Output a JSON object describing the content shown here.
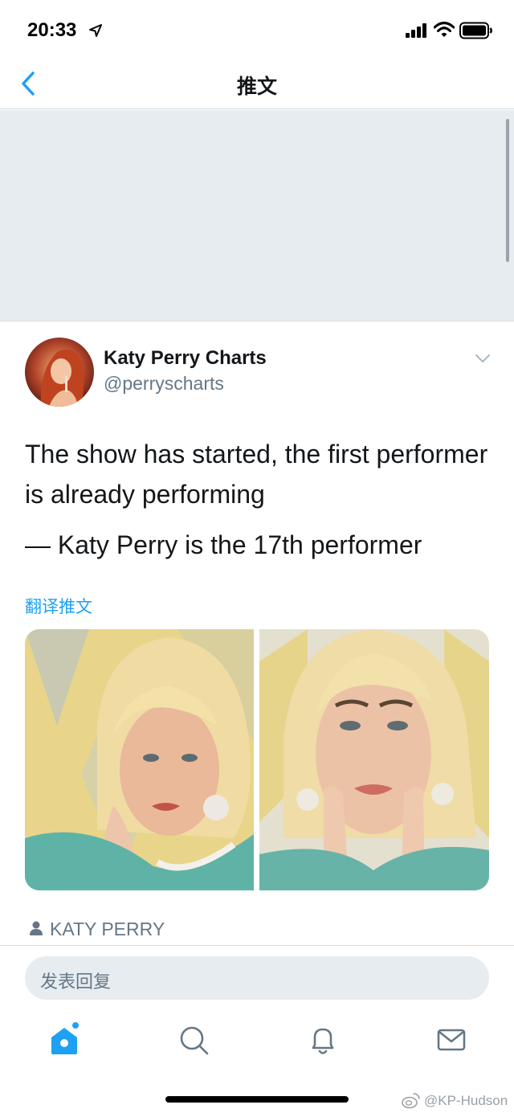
{
  "status_bar": {
    "time": "20:33"
  },
  "nav": {
    "title": "推文"
  },
  "tweet": {
    "display_name": "Katy Perry Charts",
    "handle": "@perryscharts",
    "text_line1": "The show has started, the first performer is already performing",
    "text_line2": "— Katy Perry is the 17th performer",
    "translate_label": "翻译推文",
    "media_count": 2,
    "tagged_user": "KATY PERRY"
  },
  "reply": {
    "placeholder": "发表回复"
  },
  "tabs": [
    {
      "name": "home",
      "icon": "home-icon",
      "active": true
    },
    {
      "name": "search",
      "icon": "search-icon",
      "active": false
    },
    {
      "name": "notifications",
      "icon": "bell-icon",
      "active": false
    },
    {
      "name": "messages",
      "icon": "mail-icon",
      "active": false
    }
  ],
  "watermark": {
    "text": "@KP-Hudson"
  },
  "colors": {
    "accent": "#1da1f2",
    "text_primary": "#14171a",
    "text_secondary": "#657786",
    "banner_gray": "#e6ecf0"
  }
}
